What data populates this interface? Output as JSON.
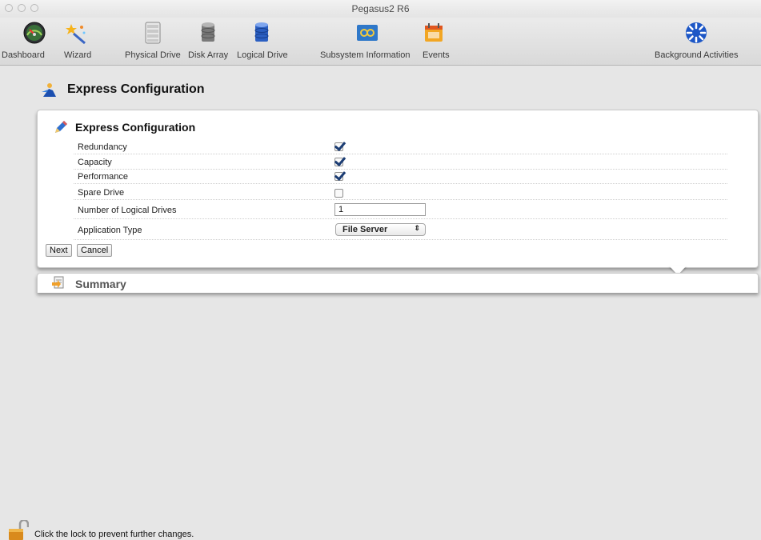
{
  "window": {
    "title": "Pegasus2 R6"
  },
  "toolbar": {
    "items": [
      {
        "label": "Dashboard",
        "icon": "speedometer-icon"
      },
      {
        "label": "Wizard",
        "icon": "wizard-wand-icon"
      },
      {
        "label": "Physical Drive",
        "icon": "physical-drive-icon"
      },
      {
        "label": "Disk Array",
        "icon": "disk-array-icon"
      },
      {
        "label": "Logical Drive",
        "icon": "logical-drive-icon"
      },
      {
        "label": "Subsystem Information",
        "icon": "subsystem-info-icon"
      },
      {
        "label": "Events",
        "icon": "events-calendar-icon"
      },
      {
        "label": "Background Activities",
        "icon": "background-activities-icon"
      }
    ]
  },
  "page": {
    "heading": "Express Configuration"
  },
  "config_panel": {
    "title": "Express Configuration",
    "rows": [
      {
        "label": "Redundancy",
        "checked": true
      },
      {
        "label": "Capacity",
        "checked": true
      },
      {
        "label": "Performance",
        "checked": true
      },
      {
        "label": "Spare Drive",
        "checked": false
      }
    ],
    "logical_drives": {
      "label": "Number of Logical Drives",
      "value": "1"
    },
    "application_type": {
      "label": "Application Type",
      "value": "File Server"
    },
    "buttons": {
      "next": "Next",
      "cancel": "Cancel"
    }
  },
  "summary_panel": {
    "title": "Summary"
  },
  "status": {
    "lock_text": "Click the lock to prevent further changes."
  },
  "colors": {
    "checkmark": "#1c3d74",
    "toolbar_bg": "#dddddd",
    "content_bg": "#e6e6e6"
  }
}
